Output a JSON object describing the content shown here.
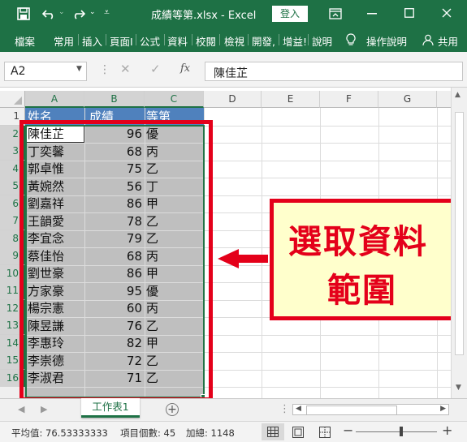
{
  "titlebar": {
    "filename": "成績等第.xlsx",
    "separator": "-",
    "app": "Excel",
    "signin_label": "登入"
  },
  "ribbon": {
    "tabs": [
      "檔案",
      "常用",
      "插入",
      "頁面I",
      "公式",
      "資料",
      "校閱",
      "檢視",
      "開發,",
      "增益!",
      "說明"
    ],
    "tell_me": "操作說明",
    "share": "共用"
  },
  "formula_bar": {
    "name_box": "A2",
    "fx_label": "fx",
    "content": "陳佳芷"
  },
  "columns": [
    "A",
    "B",
    "C",
    "D",
    "E",
    "F",
    "G"
  ],
  "rows": [
    {
      "num": "1",
      "name": "姓名",
      "score": "成績",
      "grade": "等第"
    },
    {
      "num": "2",
      "name": "陳佳芷",
      "score": "96",
      "grade": "優"
    },
    {
      "num": "3",
      "name": "丁奕馨",
      "score": "68",
      "grade": "丙"
    },
    {
      "num": "4",
      "name": "郭卓惟",
      "score": "75",
      "grade": "乙"
    },
    {
      "num": "5",
      "name": "黃婉然",
      "score": "56",
      "grade": "丁"
    },
    {
      "num": "6",
      "name": "劉嘉祥",
      "score": "86",
      "grade": "甲"
    },
    {
      "num": "7",
      "name": "王韻愛",
      "score": "78",
      "grade": "乙"
    },
    {
      "num": "8",
      "name": "李宜念",
      "score": "79",
      "grade": "乙"
    },
    {
      "num": "9",
      "name": "蔡佳怡",
      "score": "68",
      "grade": "丙"
    },
    {
      "num": "10",
      "name": "劉世豪",
      "score": "86",
      "grade": "甲"
    },
    {
      "num": "11",
      "name": "方家豪",
      "score": "95",
      "grade": "優"
    },
    {
      "num": "12",
      "name": "楊宗憲",
      "score": "60",
      "grade": "丙"
    },
    {
      "num": "13",
      "name": "陳昱謙",
      "score": "76",
      "grade": "乙"
    },
    {
      "num": "14",
      "name": "李惠玲",
      "score": "82",
      "grade": "甲"
    },
    {
      "num": "15",
      "name": "李崇德",
      "score": "72",
      "grade": "乙"
    },
    {
      "num": "16",
      "name": "李淑君",
      "score": "71",
      "grade": "乙"
    }
  ],
  "callout": {
    "line1": "選取資料",
    "line2": "範圍"
  },
  "sheet_tab": "工作表1",
  "status": {
    "average": "平均值: 76.53333333",
    "count": "項目個數: 45",
    "sum": "加總: 1148"
  },
  "colors": {
    "excel_green": "#1e7145",
    "annotation_red": "#e4001a",
    "callout_fill": "#ffffcc",
    "selection_gray": "#bfbfbf",
    "header_blue": "#4f81bd"
  }
}
